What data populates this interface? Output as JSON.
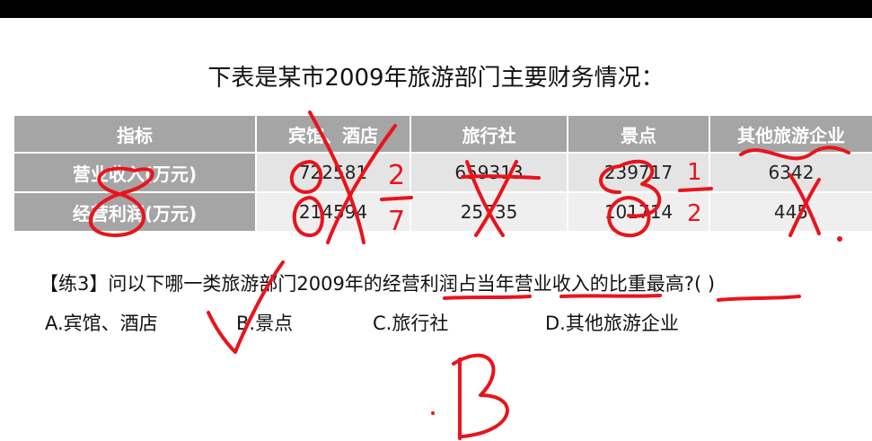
{
  "title": "下表是某市2009年旅游部门主要财务情况：",
  "table": {
    "headers": [
      "指标",
      "宾馆、酒店",
      "旅行社",
      "景点",
      "其他旅游企业"
    ],
    "rows": [
      {
        "label": "营业收入(万元)",
        "values": [
          "722581",
          "659313",
          "239717",
          "6342"
        ]
      },
      {
        "label": "经营利润(万元)",
        "values": [
          "214594",
          "25735",
          "101714",
          "445"
        ]
      }
    ]
  },
  "question": "【练3】问以下哪一类旅游部门2009年的经营利润占当年营业收入的比重最高?(    )",
  "options": [
    "A.宾馆、酒店",
    "B.景点",
    "C.旅行社",
    "D.其他旅游企业"
  ],
  "handwriting": {
    "ink_color": "#e8141c",
    "frac_num": "2",
    "frac_den": "7",
    "frac2_num": "1",
    "frac2_den": "2",
    "answer": "B"
  }
}
